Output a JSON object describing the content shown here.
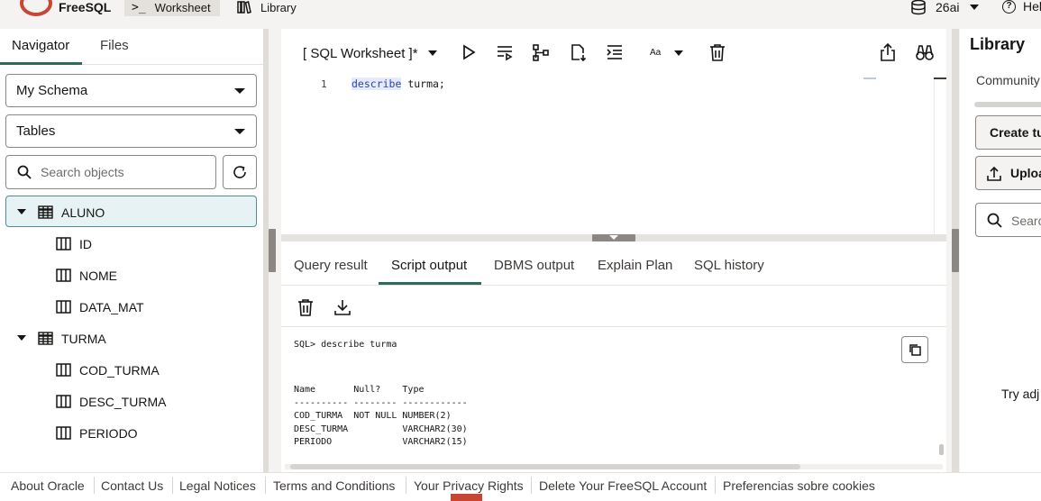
{
  "app": {
    "brand": "FreeSQL",
    "nav": [
      {
        "label": "Worksheet",
        "icon": "terminal-icon",
        "active": true
      },
      {
        "label": "Library",
        "icon": "books-icon",
        "active": false
      }
    ],
    "database": "26ai",
    "help": "Hel"
  },
  "navigator": {
    "tabs": [
      "Navigator",
      "Files"
    ],
    "schema": "My Schema",
    "object_type": "Tables",
    "search_placeholder": "Search objects",
    "tree": [
      {
        "name": "ALUNO",
        "expanded": true,
        "selected": true,
        "columns": [
          "ID",
          "NOME",
          "DATA_MAT"
        ]
      },
      {
        "name": "TURMA",
        "expanded": true,
        "selected": false,
        "columns": [
          "COD_TURMA",
          "DESC_TURMA",
          "PERIODO"
        ]
      }
    ]
  },
  "editor": {
    "worksheet_title": "[ SQL Worksheet ]*",
    "font_size_label": "Aa",
    "line_number": "1",
    "code_keyword": "describe",
    "code_rest": " turma;"
  },
  "results": {
    "tabs": [
      "Query result",
      "Script output",
      "DBMS output",
      "Explain Plan",
      "SQL history"
    ],
    "active_tab": "Script output",
    "output_lines": [
      "SQL> describe turma",
      "",
      "",
      "Name       Null?    Type",
      "---------- -------- ------------",
      "COD_TURMA  NOT NULL NUMBER(2)",
      "DESC_TURMA          VARCHAR2(30)",
      "PERIODO             VARCHAR2(15)"
    ]
  },
  "library": {
    "title": "Library",
    "community": "Community",
    "create_button": "Create tu",
    "upload_button": "Uploa",
    "search_placeholder": "Searc",
    "hint": "Try adj"
  },
  "footer": {
    "links": [
      "About Oracle",
      "Contact Us",
      "Legal Notices",
      "Terms and Conditions",
      "Your Privacy Rights",
      "Delete Your FreeSQL Account",
      "Preferencias sobre cookies"
    ]
  },
  "colors": {
    "accent_green": "#2c6b56",
    "oracle_red": "#c74634",
    "selection_bg": "#e6f2f3",
    "selection_border": "#4e8f97"
  }
}
